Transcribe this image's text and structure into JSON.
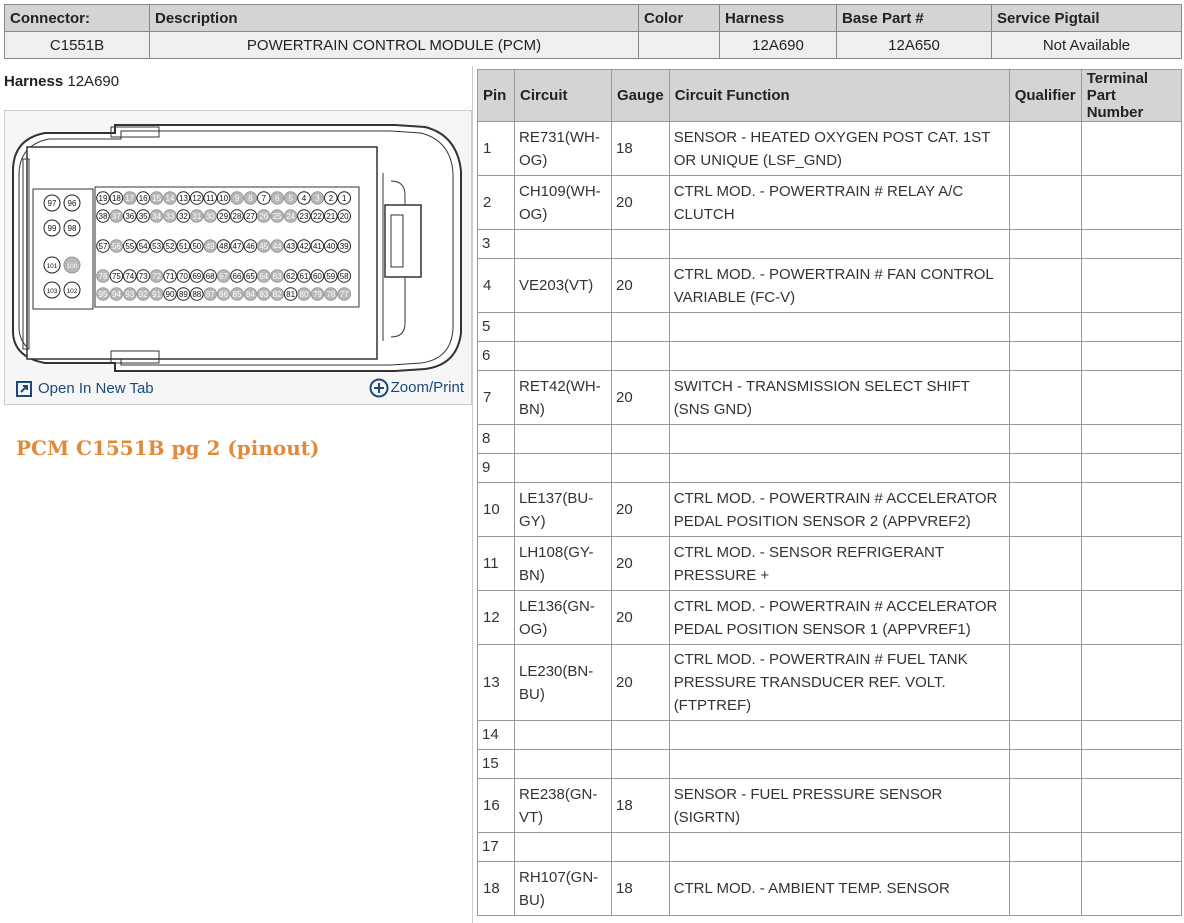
{
  "connector_table": {
    "headers": [
      "Connector:",
      "Description",
      "Color",
      "Harness",
      "Base Part #",
      "Service Pigtail"
    ],
    "row": {
      "connector": "C1551B",
      "description": "POWERTRAIN CONTROL MODULE (PCM)",
      "color": "",
      "harness": "12A690",
      "base_part": "12A650",
      "service_pigtail": "Not Available"
    }
  },
  "left_panel": {
    "harness_label": "Harness",
    "harness_value": "12A690",
    "open_in_new_tab": "Open In New Tab",
    "zoom_print": "Zoom/Print",
    "caption": "PCM C1551B pg 2 (pinout)"
  },
  "connector_diagram": {
    "row1": [
      "19",
      "18",
      "17",
      "16",
      "15",
      "14",
      "13",
      "12",
      "11",
      "10",
      "9",
      "8",
      "7",
      "6",
      "5",
      "4",
      "3",
      "2",
      "1"
    ],
    "row2": [
      "38",
      "37",
      "36",
      "35",
      "34",
      "33",
      "32",
      "31",
      "30",
      "29",
      "28",
      "27",
      "26",
      "25",
      "24",
      "23",
      "22",
      "21",
      "20"
    ],
    "row3": [
      "57",
      "56",
      "55",
      "54",
      "53",
      "52",
      "51",
      "50",
      "49",
      "48",
      "47",
      "46",
      "45",
      "44",
      "43",
      "42",
      "41",
      "40",
      "39"
    ],
    "row4": [
      "76",
      "75",
      "74",
      "73",
      "72",
      "71",
      "70",
      "69",
      "68",
      "67",
      "66",
      "65",
      "64",
      "63",
      "62",
      "61",
      "60",
      "59",
      "58"
    ],
    "row5": [
      "95",
      "94",
      "93",
      "92",
      "91",
      "90",
      "89",
      "88",
      "87",
      "86",
      "85",
      "84",
      "83",
      "82",
      "81",
      "80",
      "79",
      "78",
      "77"
    ],
    "left_pins": [
      "97",
      "96",
      "99",
      "98",
      "101",
      "100",
      "103",
      "102"
    ]
  },
  "pin_table": {
    "headers": [
      "Pin",
      "Circuit",
      "Gauge",
      "Circuit Function",
      "Qualifier",
      "Terminal Part Number"
    ],
    "rows": [
      {
        "pin": "1",
        "circuit": "RE731(WH-OG)",
        "gauge": "18",
        "function": "SENSOR - HEATED OXYGEN POST CAT. 1ST OR UNIQUE (LSF_GND)",
        "qualifier": "",
        "terminal": ""
      },
      {
        "pin": "2",
        "circuit": "CH109(WH-OG)",
        "gauge": "20",
        "function": "CTRL MOD. - POWERTRAIN # RELAY A/C CLUTCH",
        "qualifier": "",
        "terminal": ""
      },
      {
        "pin": "3",
        "circuit": "",
        "gauge": "",
        "function": "",
        "qualifier": "",
        "terminal": ""
      },
      {
        "pin": "4",
        "circuit": "VE203(VT)",
        "gauge": "20",
        "function": "CTRL MOD. - POWERTRAIN # FAN CONTROL VARIABLE (FC-V)",
        "qualifier": "",
        "terminal": ""
      },
      {
        "pin": "5",
        "circuit": "",
        "gauge": "",
        "function": "",
        "qualifier": "",
        "terminal": ""
      },
      {
        "pin": "6",
        "circuit": "",
        "gauge": "",
        "function": "",
        "qualifier": "",
        "terminal": ""
      },
      {
        "pin": "7",
        "circuit": "RET42(WH-BN)",
        "gauge": "20",
        "function": "SWITCH - TRANSMISSION SELECT SHIFT (SNS GND)",
        "qualifier": "",
        "terminal": ""
      },
      {
        "pin": "8",
        "circuit": "",
        "gauge": "",
        "function": "",
        "qualifier": "",
        "terminal": ""
      },
      {
        "pin": "9",
        "circuit": "",
        "gauge": "",
        "function": "",
        "qualifier": "",
        "terminal": ""
      },
      {
        "pin": "10",
        "circuit": "LE137(BU-GY)",
        "gauge": "20",
        "function": "CTRL MOD. - POWERTRAIN # ACCELERATOR PEDAL POSITION SENSOR 2 (APPVREF2)",
        "qualifier": "",
        "terminal": ""
      },
      {
        "pin": "11",
        "circuit": "LH108(GY-BN)",
        "gauge": "20",
        "function": "CTRL MOD. - SENSOR REFRIGERANT PRESSURE +",
        "qualifier": "",
        "terminal": ""
      },
      {
        "pin": "12",
        "circuit": "LE136(GN-OG)",
        "gauge": "20",
        "function": "CTRL MOD. - POWERTRAIN # ACCELERATOR PEDAL POSITION SENSOR 1 (APPVREF1)",
        "qualifier": "",
        "terminal": ""
      },
      {
        "pin": "13",
        "circuit": "LE230(BN-BU)",
        "gauge": "20",
        "function": "CTRL MOD. - POWERTRAIN # FUEL TANK PRESSURE TRANSDUCER REF. VOLT. (FTPTREF)",
        "qualifier": "",
        "terminal": ""
      },
      {
        "pin": "14",
        "circuit": "",
        "gauge": "",
        "function": "",
        "qualifier": "",
        "terminal": ""
      },
      {
        "pin": "15",
        "circuit": "",
        "gauge": "",
        "function": "",
        "qualifier": "",
        "terminal": ""
      },
      {
        "pin": "16",
        "circuit": "RE238(GN-VT)",
        "gauge": "18",
        "function": "SENSOR - FUEL PRESSURE SENSOR (SIGRTN)",
        "qualifier": "",
        "terminal": ""
      },
      {
        "pin": "17",
        "circuit": "",
        "gauge": "",
        "function": "",
        "qualifier": "",
        "terminal": ""
      },
      {
        "pin": "18",
        "circuit": "RH107(GN-BU)",
        "gauge": "18",
        "function": "CTRL MOD. - AMBIENT TEMP. SENSOR",
        "qualifier": "",
        "terminal": ""
      }
    ]
  },
  "colors": {
    "header_bg": "#d4d4d4",
    "caption": "#e08a3a",
    "link": "#1a4a7a"
  }
}
